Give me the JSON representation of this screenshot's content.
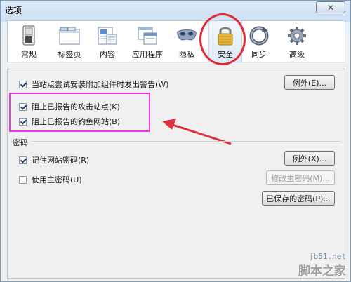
{
  "window": {
    "title": "选项",
    "close_label": "✕"
  },
  "toolbar": {
    "tabs": [
      {
        "label": "常规",
        "icon": "switch-icon"
      },
      {
        "label": "标签页",
        "icon": "tabs-window-icon"
      },
      {
        "label": "内容",
        "icon": "content-page-icon"
      },
      {
        "label": "应用程序",
        "icon": "applications-icon"
      },
      {
        "label": "隐私",
        "icon": "privacy-mask-icon"
      },
      {
        "label": "安全",
        "icon": "padlock-icon"
      },
      {
        "label": "同步",
        "icon": "sync-icon"
      },
      {
        "label": "高级",
        "icon": "gear-icon"
      }
    ],
    "active_index": 5
  },
  "security": {
    "warn_addons": {
      "label": "当站点尝试安装附加组件时发出警告(W)",
      "checked": true
    },
    "exceptions1_button": "例外(E)...",
    "block_attack": {
      "label": "阻止已报告的攻击站点(K)",
      "checked": true
    },
    "block_forgery": {
      "label": "阻止已报告的钓鱼网站(B)",
      "checked": true
    }
  },
  "passwords": {
    "group_label": "密码",
    "remember": {
      "label": "记住网站密码(R)",
      "checked": true
    },
    "exceptions2_button": "例外(X)...",
    "master": {
      "label": "使用主密码(U)",
      "checked": false
    },
    "change_master_button": "修改主密码(M)...",
    "saved_passwords_button": "已保存的密码(P)..."
  },
  "watermark": {
    "site": "jb51.net",
    "brand": "脚本之家"
  },
  "colors": {
    "annotation_circle": "#e02a37",
    "annotation_box": "#e83be0",
    "annotation_arrow": "#e0303a"
  }
}
